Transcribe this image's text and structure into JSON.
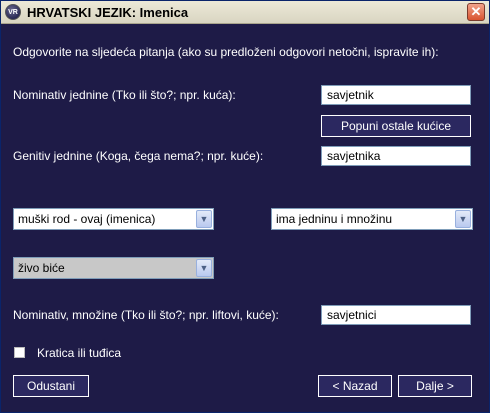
{
  "window": {
    "title": "HRVATSKI JEZIK: Imenica",
    "icon_text": "VR",
    "close_symbol": "✕"
  },
  "form": {
    "instruction": "Odgovorite na sljedeća pitanja (ako su predloženi odgovori netočni, ispravite ih):",
    "nominativ_jednine_label": "Nominativ jednine (Tko ili što?; npr. kuća):",
    "nominativ_jednine_value": "savjetnik",
    "fill_button": "Popuni ostale kućice",
    "genitiv_jednine_label": "Genitiv jednine (Koga, čega nema?; npr. kuće):",
    "genitiv_jednine_value": "savjetnika",
    "gender_select": "muški rod - ovaj (imenica)",
    "number_select": "ima jedninu i množinu",
    "animacy_select": "živo biće",
    "nominativ_mnozine_label": "Nominativ, množine (Tko ili što?; npr. liftovi, kuće):",
    "nominativ_mnozine_value": "savjetnici",
    "abbreviation_label": "Kratica ili tuđica",
    "abbreviation_checked": false
  },
  "buttons": {
    "cancel": "Odustani",
    "back": "< Nazad",
    "next": "Dalje >"
  },
  "icons": {
    "dropdown": "chevron-down-icon",
    "close": "close-icon"
  }
}
